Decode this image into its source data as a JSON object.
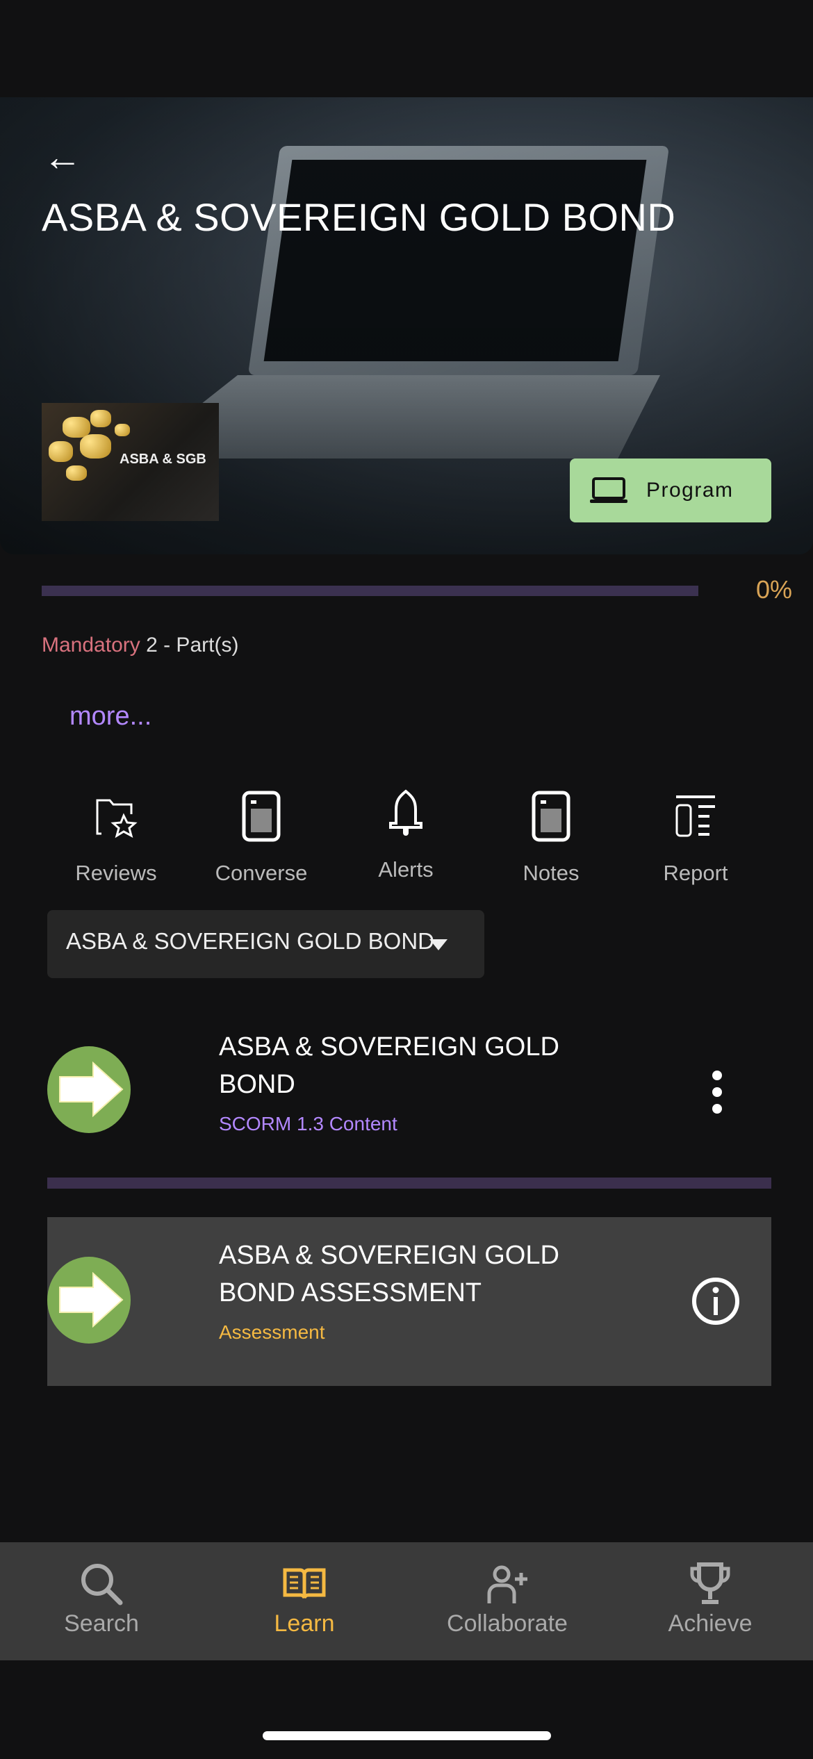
{
  "header": {
    "title": "ASBA & SOVEREIGN GOLD BOND",
    "back_icon": "arrow-left-icon",
    "thumbnail_label": "ASBA & SGB",
    "program_button": "Program"
  },
  "progress": {
    "percent": 0,
    "label": "0%"
  },
  "meta": {
    "mandatory": "Mandatory",
    "parts": " 2 - Part(s)",
    "more": "more..."
  },
  "actions": [
    {
      "label": "Reviews",
      "icon": "folder-star-icon"
    },
    {
      "label": "Converse",
      "icon": "phone-icon"
    },
    {
      "label": "Alerts",
      "icon": "bell-icon"
    },
    {
      "label": "Notes",
      "icon": "phone-icon"
    },
    {
      "label": "Report",
      "icon": "report-icon"
    }
  ],
  "dropdown": {
    "selected": "ASBA & SOVEREIGN GOLD BOND"
  },
  "items": [
    {
      "title": "ASBA & SOVEREIGN GOLD BOND",
      "type": "SCORM 1.3 Content",
      "type_color": "#b388ff",
      "action_icon": "more-vertical-icon"
    },
    {
      "title": "ASBA & SOVEREIGN GOLD BOND ASSESSMENT",
      "type": "Assessment",
      "type_color": "#f5b942",
      "action_icon": "info-icon"
    }
  ],
  "nav": [
    {
      "label": "Search",
      "active": false
    },
    {
      "label": "Learn",
      "active": true
    },
    {
      "label": "Collaborate",
      "active": false
    },
    {
      "label": "Achieve",
      "active": false
    }
  ],
  "colors": {
    "accent": "#f5b942",
    "program_button": "#a8d99a",
    "start_icon": "#7ead54"
  }
}
